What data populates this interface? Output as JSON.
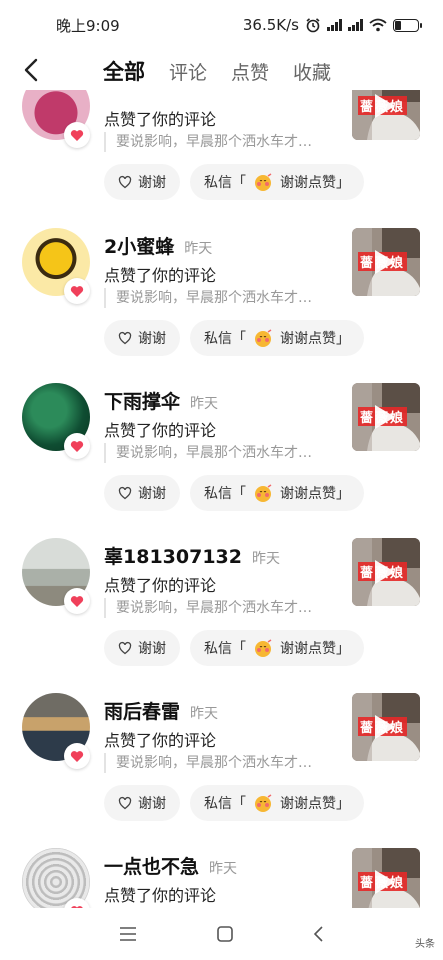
{
  "status_bar": {
    "time": "晚上9:09",
    "speed": "36.5K/s",
    "icons": [
      "alarm-icon",
      "signal-icon",
      "hd-signal-icon",
      "wifi-icon",
      "battery-icon"
    ],
    "battery_level": 0.25
  },
  "nav": {
    "back_icon": "chevron-left-icon",
    "tabs": [
      {
        "label": "全部",
        "active": true
      },
      {
        "label": "评论",
        "active": false
      },
      {
        "label": "点赞",
        "active": false
      },
      {
        "label": "收藏",
        "active": false
      }
    ]
  },
  "items": [
    {
      "name": "",
      "when": "",
      "action": "点赞了你的评论",
      "quote": "要说影响，早晨那个洒水车才…",
      "thanks_label": "谢谢",
      "dm_label": "私信「",
      "dm_reply": "谢谢点赞」",
      "thumb_tag": "薔薇娘"
    },
    {
      "name": "2小蜜蜂",
      "when": "昨天",
      "action": "点赞了你的评论",
      "quote": "要说影响，早晨那个洒水车才…",
      "thanks_label": "谢谢",
      "dm_label": "私信「",
      "dm_reply": "谢谢点赞」",
      "thumb_tag": "薔薇娘"
    },
    {
      "name": "下雨撑伞",
      "when": "昨天",
      "action": "点赞了你的评论",
      "quote": "要说影响，早晨那个洒水车才…",
      "thanks_label": "谢谢",
      "dm_label": "私信「",
      "dm_reply": "谢谢点赞」",
      "thumb_tag": "薔薇娘"
    },
    {
      "name": "辜181307132",
      "when": "昨天",
      "action": "点赞了你的评论",
      "quote": "要说影响，早晨那个洒水车才…",
      "thanks_label": "谢谢",
      "dm_label": "私信「",
      "dm_reply": "谢谢点赞」",
      "thumb_tag": "薔薇娘"
    },
    {
      "name": "雨后春雷",
      "when": "昨天",
      "action": "点赞了你的评论",
      "quote": "要说影响，早晨那个洒水车才…",
      "thanks_label": "谢谢",
      "dm_label": "私信「",
      "dm_reply": "谢谢点赞」",
      "thumb_tag": "薔薇娘"
    },
    {
      "name": "一点也不急",
      "when": "昨天",
      "action": "点赞了你的评论",
      "quote": "",
      "thanks_label": "",
      "dm_label": "",
      "dm_reply": "",
      "thumb_tag": "薔薇娘"
    }
  ],
  "bottom_bar": {
    "icons": [
      "menu-icon",
      "home-icon",
      "back-icon"
    ],
    "watermark": "头条"
  },
  "colors": {
    "heart": "#f0405a",
    "accent_text": "#111111",
    "muted": "#999999"
  }
}
